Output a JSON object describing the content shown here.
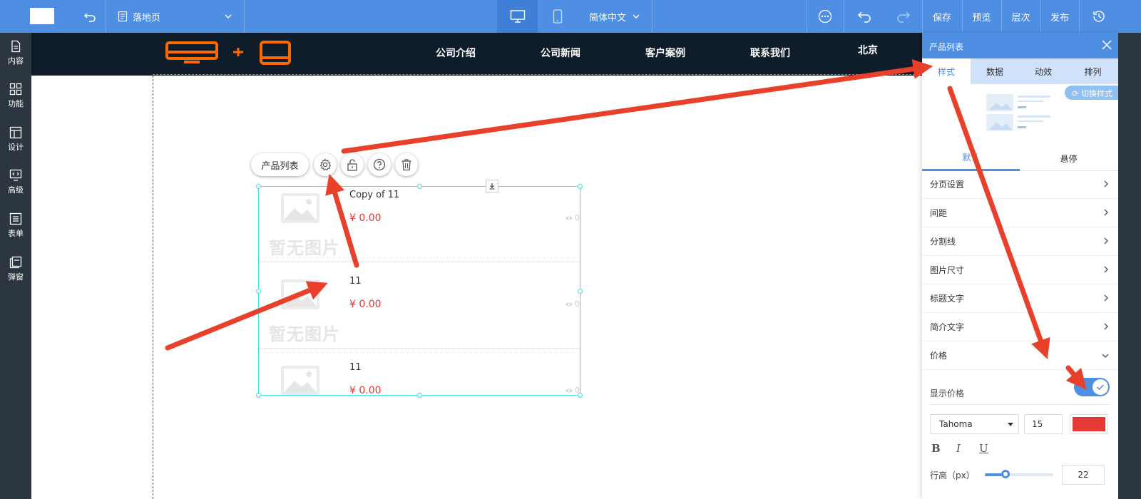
{
  "toolbar": {
    "page_select_label": "落地页",
    "language_label": "简体中文",
    "save_label": "保存",
    "preview_label": "预览",
    "layers_label": "层次",
    "publish_label": "发布"
  },
  "sidebar": {
    "items": [
      {
        "label": "内容",
        "icon": "file-icon"
      },
      {
        "label": "功能",
        "icon": "grid-icon"
      },
      {
        "label": "设计",
        "icon": "layout-icon"
      },
      {
        "label": "高级",
        "icon": "code-monitor-icon"
      },
      {
        "label": "表单",
        "icon": "list-icon"
      },
      {
        "label": "弹窗",
        "icon": "popup-icon"
      }
    ]
  },
  "site_nav": {
    "items": [
      "公司介绍",
      "公司新闻",
      "客户案例",
      "联系我们",
      "北京"
    ],
    "brand_color": "#ff6a00"
  },
  "floating_toolbar": {
    "label": "产品列表"
  },
  "product_list": {
    "placeholder_text": "暂无图片",
    "items": [
      {
        "title": "Copy of 11",
        "price": "¥ 0.00",
        "views": "0"
      },
      {
        "title": "11",
        "price": "¥ 0.00",
        "views": "0"
      },
      {
        "title": "11",
        "price": "¥ 0.00",
        "views": "0"
      }
    ]
  },
  "panel": {
    "title": "产品列表",
    "tabs": [
      "样式",
      "数据",
      "动效",
      "排列"
    ],
    "switch_style_label": "切换样式",
    "subtabs": [
      "默认",
      "悬停"
    ],
    "sections": [
      "分页设置",
      "间距",
      "分割线",
      "图片尺寸",
      "标题文字",
      "简介文字",
      "价格"
    ],
    "show_price_label": "显示价格",
    "show_price_on": true,
    "font_family": "Tahoma",
    "font_size": "15",
    "price_color": "#e53935",
    "format_bold": "B",
    "format_italic": "I",
    "format_underline": "U",
    "line_height_label": "行高（px）",
    "line_height_value": "22",
    "line_height_fraction": 0.3
  },
  "colors": {
    "toolbar_blue": "#4e8ee3",
    "sidebar_dark": "#2b3640",
    "nav_dark": "#0f1c2a",
    "annotation_red": "#e8402a",
    "selection_cyan": "#3ee0ea"
  }
}
